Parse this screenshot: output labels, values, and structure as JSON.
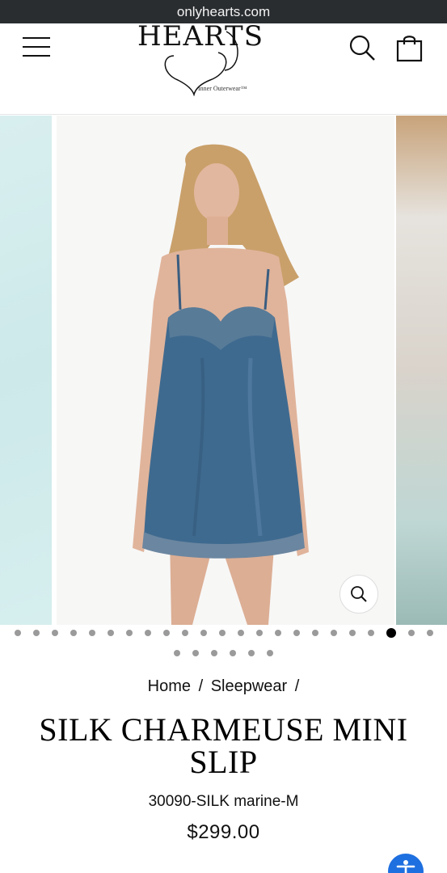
{
  "browser": {
    "url": "onlyhearts.com"
  },
  "header": {
    "logo_text": "HEARTS",
    "tagline": "Inner Outerwear™",
    "icons": [
      "menu-icon",
      "search-icon",
      "cart-icon"
    ]
  },
  "gallery": {
    "slide_count": 29,
    "active_index": 20,
    "zoom_icon": "zoom-icon",
    "colors": {
      "dress": "#3f6a8f",
      "skin": "#e0b49b",
      "hair": "#c9a06a"
    }
  },
  "breadcrumb": {
    "items": [
      "Home",
      "Sleepwear"
    ],
    "separator": "/"
  },
  "product": {
    "title_line1": "SILK CHARMEUSE MINI",
    "title_line2": "SLIP",
    "sku": "30090-SILK marine-M",
    "price": "$299.00"
  },
  "accessibility": {
    "icon": "accessibility-icon",
    "color": "#1e6fe0"
  }
}
